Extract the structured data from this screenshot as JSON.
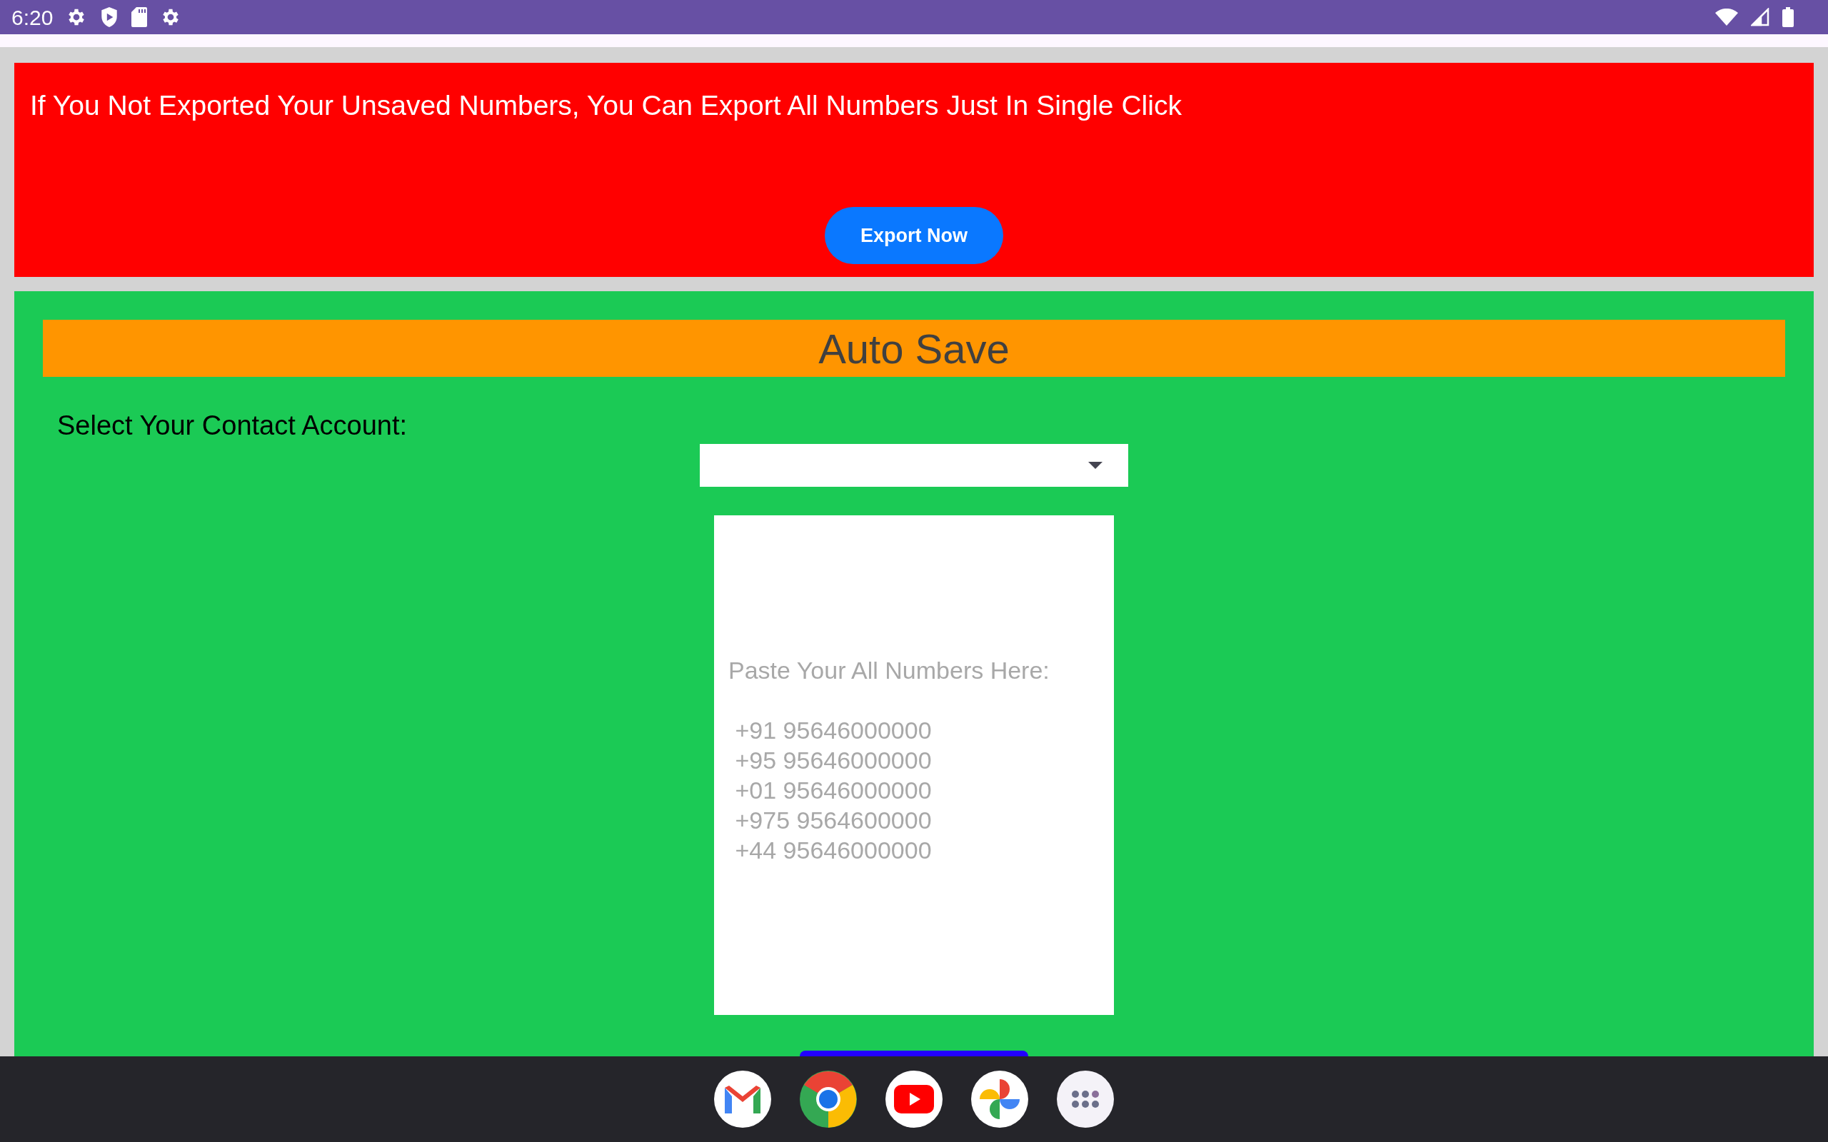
{
  "status_bar": {
    "time": "6:20"
  },
  "export_banner": {
    "message": "If You Not Exported Your Unsaved Numbers, You Can Export All Numbers Just In Single Click",
    "button": "Export Now"
  },
  "auto_save": {
    "title": "Auto Save",
    "account_label": "Select Your Contact Account:",
    "numbers_field": {
      "placeholder": "Paste Your All Numbers Here:\n\n +91 95646000000\n +95 95646000000\n +01 95646000000\n +975 9564600000\n +44 95646000000"
    }
  }
}
